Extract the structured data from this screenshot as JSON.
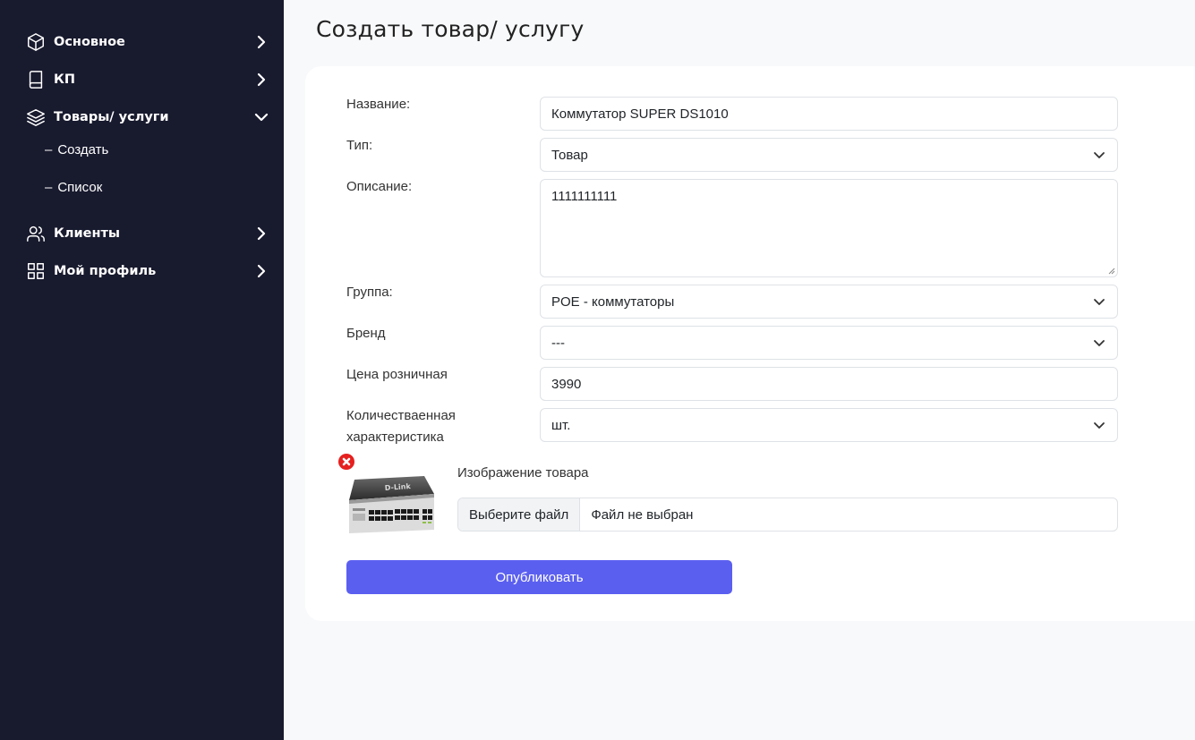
{
  "sidebar": {
    "items": [
      {
        "label": "Основное",
        "icon": "cube-icon",
        "expanded": false
      },
      {
        "label": "КП",
        "icon": "book-icon",
        "expanded": false
      },
      {
        "label": "Товары/ услуги",
        "icon": "layers-icon",
        "expanded": true,
        "children": [
          {
            "label": "Создать"
          },
          {
            "label": "Список"
          }
        ]
      },
      {
        "label": "Клиенты",
        "icon": "users-icon",
        "expanded": false
      },
      {
        "label": "Мой профиль",
        "icon": "grid-icon",
        "expanded": false
      }
    ]
  },
  "page": {
    "title": "Создать товар/ услугу"
  },
  "form": {
    "name": {
      "label": "Название:",
      "value": "Коммутатор SUPER DS1010"
    },
    "type": {
      "label": "Тип:",
      "value": "Товар"
    },
    "description": {
      "label": "Описание:",
      "value": "1111111111"
    },
    "group": {
      "label": "Группа:",
      "value": "POE - коммутаторы"
    },
    "brand": {
      "label": "Бренд",
      "value": "---"
    },
    "price": {
      "label": "Цена розничная",
      "value": "3990"
    },
    "unit": {
      "label_line1": "Количестваенная",
      "label_line2": "характеристика",
      "value": "шт."
    },
    "image": {
      "label": "Изображение товара",
      "choose_button": "Выберите файл",
      "status": "Файл не выбран",
      "logo_text": "D-Link"
    },
    "submit_label": "Опубликовать"
  },
  "colors": {
    "sidebar_bg": "#181a2e",
    "page_bg": "#f8f9fb",
    "accent": "#5b5ff0",
    "remove": "#e5201e"
  }
}
